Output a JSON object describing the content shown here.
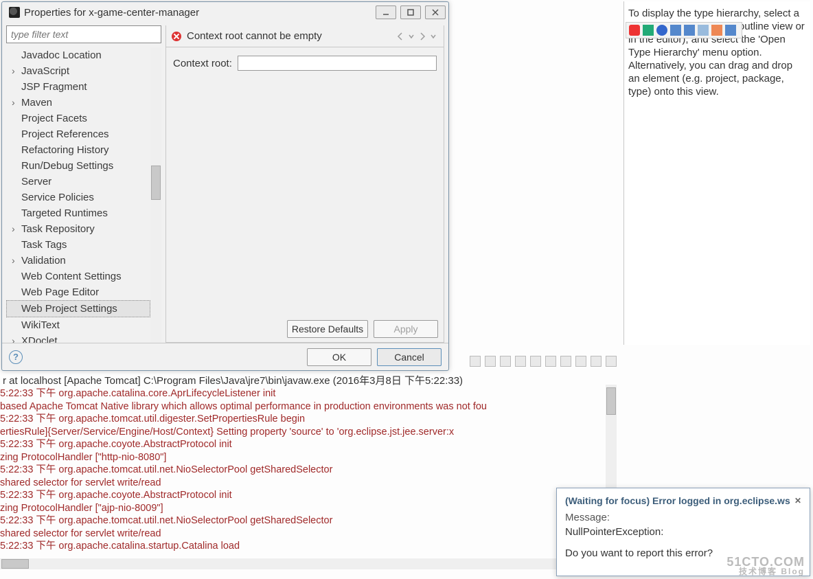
{
  "dialog": {
    "title": "Properties for x-game-center-manager",
    "filter_placeholder": "type filter text",
    "tree": [
      {
        "label": "Javadoc Location",
        "exp": false
      },
      {
        "label": "JavaScript",
        "exp": true
      },
      {
        "label": "JSP Fragment",
        "exp": false
      },
      {
        "label": "Maven",
        "exp": true
      },
      {
        "label": "Project Facets",
        "exp": false
      },
      {
        "label": "Project References",
        "exp": false
      },
      {
        "label": "Refactoring History",
        "exp": false
      },
      {
        "label": "Run/Debug Settings",
        "exp": false
      },
      {
        "label": "Server",
        "exp": false
      },
      {
        "label": "Service Policies",
        "exp": false
      },
      {
        "label": "Targeted Runtimes",
        "exp": false
      },
      {
        "label": "Task Repository",
        "exp": true
      },
      {
        "label": "Task Tags",
        "exp": false
      },
      {
        "label": "Validation",
        "exp": true
      },
      {
        "label": "Web Content Settings",
        "exp": false
      },
      {
        "label": "Web Page Editor",
        "exp": false
      },
      {
        "label": "Web Project Settings",
        "exp": false,
        "selected": true
      },
      {
        "label": "WikiText",
        "exp": false
      },
      {
        "label": "XDoclet",
        "exp": true
      }
    ],
    "error_msg": "Context root cannot be empty",
    "field_label": "Context root:",
    "field_value": "",
    "restore": "Restore Defaults",
    "apply": "Apply",
    "ok": "OK",
    "cancel": "Cancel"
  },
  "sidepanel": {
    "text": "To display the type hierarchy, select a type (for example in the outline view or in the editor), and select the 'Open Type Hierarchy' menu option. Alternatively, you can drag and drop an element (e.g. project, package, type) onto this view."
  },
  "console": {
    "title": "r at localhost [Apache Tomcat] C:\\Program Files\\Java\\jre7\\bin\\javaw.exe (2016年3月8日 下午5:22:33)",
    "lines": [
      "5:22:33 下午 org.apache.catalina.core.AprLifecycleListener init",
      "based Apache Tomcat Native library which allows optimal performance in production environments was not fou",
      "5:22:33 下午 org.apache.tomcat.util.digester.SetPropertiesRule begin",
      "ertiesRule]{Server/Service/Engine/Host/Context} Setting property 'source' to 'org.eclipse.jst.jee.server:x",
      "5:22:33 下午 org.apache.coyote.AbstractProtocol init",
      "zing ProtocolHandler [\"http-nio-8080\"]",
      "5:22:33 下午 org.apache.tomcat.util.net.NioSelectorPool getSharedSelector",
      "shared selector for servlet write/read",
      "5:22:33 下午 org.apache.coyote.AbstractProtocol init",
      "zing ProtocolHandler [\"ajp-nio-8009\"]",
      "5:22:33 下午 org.apache.tomcat.util.net.NioSelectorPool getSharedSelector",
      "shared selector for servlet write/read",
      "5:22:33 下午 org.apache.catalina.startup.Catalina load"
    ]
  },
  "popup": {
    "title": "(Waiting for focus) Error logged in org.eclipse.ws",
    "message_label": "Message:",
    "message": "NullPointerException:",
    "question": "Do you want to report this error?"
  },
  "watermark": {
    "main": "51CTO.COM",
    "sub": "技术博客  Blog"
  }
}
